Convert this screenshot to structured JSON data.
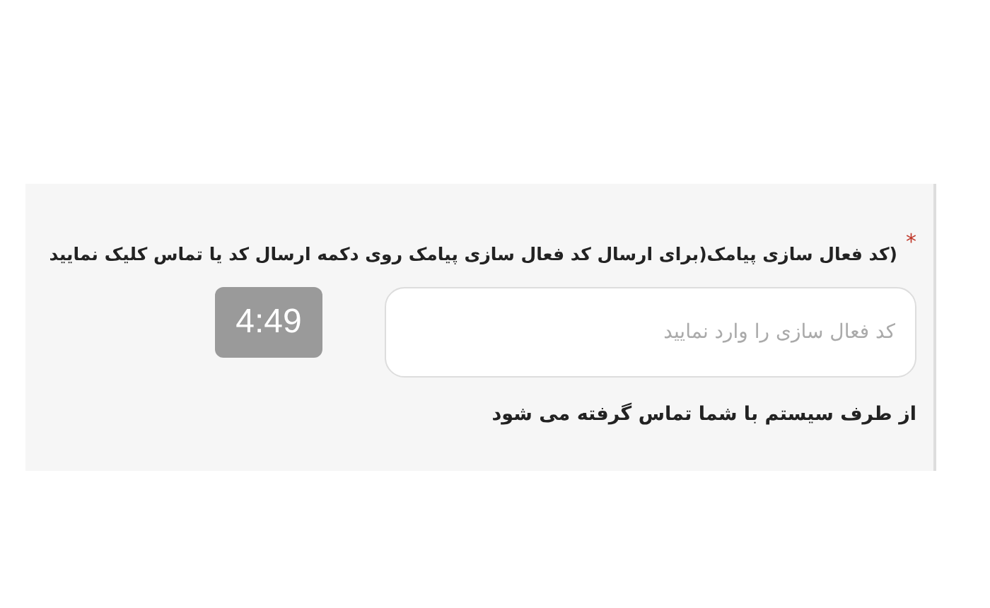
{
  "field": {
    "required_mark": "*",
    "label": "(کد فعال سازی پیامک(برای ارسال کد فعال سازی پیامک روی دکمه ارسال کد یا تماس کلیک نمایید",
    "placeholder": "کد فعال سازی را وارد نمایید",
    "timer": "4:49",
    "note": "از طرف سیستم با شما تماس گرفته می شود"
  }
}
